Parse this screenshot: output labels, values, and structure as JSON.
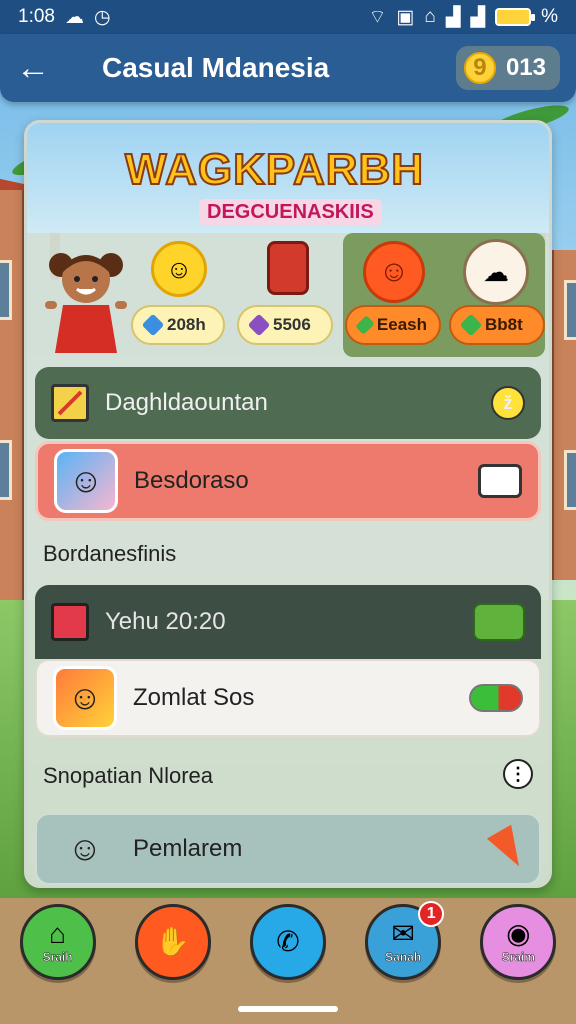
{
  "status_bar": {
    "time": "1:08",
    "icons_left": [
      "cloud-sync-icon",
      "clock-icon"
    ],
    "icons_right": [
      "wifi-icon",
      "sim-icon",
      "lock-icon",
      "signal-icon",
      "signal-icon",
      "battery-icon"
    ],
    "battery_text": "%"
  },
  "app_bar": {
    "title": "Casual Mdanesia",
    "coins": "013",
    "coin_symbol": "9"
  },
  "banner": {
    "title": "WAGKPARBH",
    "subtitle": "DEGCUENASKIIS"
  },
  "stats": {
    "pill_1": "208h",
    "pill_2": "5506",
    "pill_3": "Eeash",
    "pill_4": "Bb8t"
  },
  "rows": {
    "row_1": "Daghldaountan",
    "row_1_badge": "ž",
    "row_2": "Besdoraso",
    "section_1": "Bordanesfinis",
    "row_3": "Yehu 20:20",
    "row_4": "Zomlat Sos",
    "section_2": "Snopatian Nlorea",
    "section_2_info": "⋮",
    "row_5": "Pemlarem"
  },
  "bottom_nav": {
    "items": [
      {
        "label": "Sraih"
      },
      {
        "label": ""
      },
      {
        "label": ""
      },
      {
        "label": "Sanah",
        "badge": "1"
      },
      {
        "label": "Sraim"
      }
    ]
  },
  "colors": {
    "app_bar": "#2a5d93",
    "status_bar": "#1f4f82",
    "accent_orange": "#ff5a1f",
    "accent_green": "#4ec04a"
  }
}
